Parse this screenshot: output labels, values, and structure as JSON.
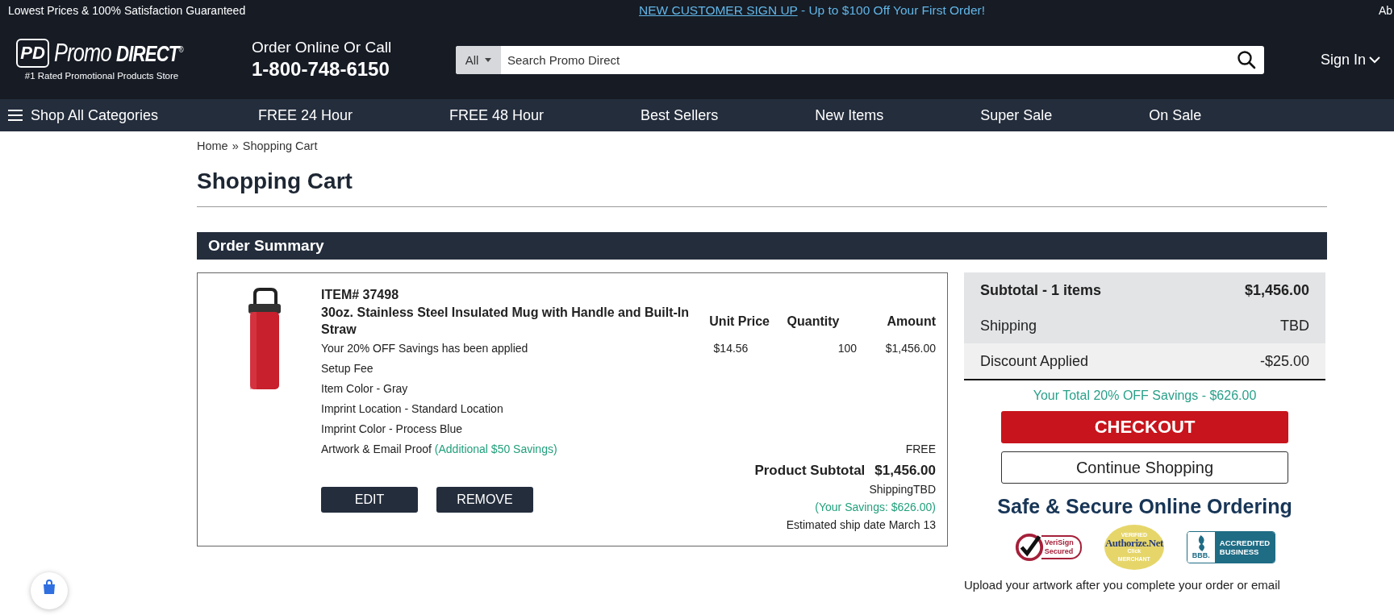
{
  "top_bar": {
    "guarantee": "Lowest Prices & 100% Satisfaction Guaranteed",
    "promo_link": "NEW CUSTOMER SIGN UP",
    "promo_text": " - Up to $100 Off Your First Order!",
    "right_text": "Ab"
  },
  "header": {
    "logo": {
      "mark": "PD",
      "name_1": "Promo",
      "name_2": "DIRECT",
      "registered": "®",
      "tagline": "#1 Rated Promotional Products Store"
    },
    "contact": {
      "label": "Order Online Or Call",
      "phone": "1-800-748-6150"
    },
    "search": {
      "scope": "All",
      "placeholder": "Search Promo Direct"
    },
    "sign_in": "Sign In"
  },
  "nav": {
    "menu_label": "Shop All Categories",
    "items": [
      "FREE 24 Hour",
      "FREE 48 Hour",
      "Best Sellers",
      "New Items",
      "Super Sale",
      "On Sale"
    ]
  },
  "breadcrumb": {
    "items": [
      "Home",
      "Shopping Cart"
    ],
    "separator": "»"
  },
  "page_title": "Shopping Cart",
  "section_title": "Order Summary",
  "cart_item": {
    "item_number": "ITEM# 37498",
    "name": "30oz. Stainless Steel Insulated Mug with Handle and Built-In Straw",
    "columns": [
      "Unit Price",
      "Quantity",
      "Amount"
    ],
    "values": [
      "$14.56",
      "100",
      "$1,456.00"
    ],
    "details": [
      {
        "text": "Your 20% OFF Savings has been applied"
      },
      {
        "text": "Setup Fee"
      },
      {
        "text": "Item Color - Gray"
      },
      {
        "text": "Imprint Location - Standard Location"
      },
      {
        "text": "Imprint Color - Process Blue"
      },
      {
        "text": "Artwork & Email Proof",
        "note": "(Additional $50 Savings)",
        "price": "FREE"
      }
    ],
    "buttons": [
      "EDIT",
      "REMOVE"
    ],
    "subtotal_label": "Product Subtotal",
    "subtotal_value": "$1,456.00",
    "shipping": "ShippingTBD",
    "savings": "(Your Savings: $626.00)",
    "ship_date": "Estimated ship date March 13"
  },
  "summary": {
    "rows": [
      {
        "kind": "total",
        "label": "Subtotal - 1 items",
        "value": "$1,456.00"
      },
      {
        "kind": "line",
        "label": "Shipping",
        "value": "TBD"
      },
      {
        "kind": "discount",
        "label": "Discount Applied",
        "value": "-$25.00"
      }
    ],
    "savings_line": "Your Total 20% OFF Savings - $626.00",
    "checkout": "CHECKOUT",
    "continue": "Continue Shopping",
    "secure_title": "Safe & Secure Online Ordering",
    "badges": [
      {
        "kind": "verisign",
        "lines": [
          "VeriSign",
          "Secured"
        ]
      },
      {
        "kind": "authorize",
        "lines": [
          "VERIFIED",
          "Authorize.Net",
          "Click",
          "MERCHANT"
        ]
      },
      {
        "kind": "bbb",
        "lines": [
          "BBB.",
          "ACCREDITED",
          "BUSINESS"
        ]
      }
    ],
    "upload_note": "Upload your artwork after you complete your order or email"
  }
}
